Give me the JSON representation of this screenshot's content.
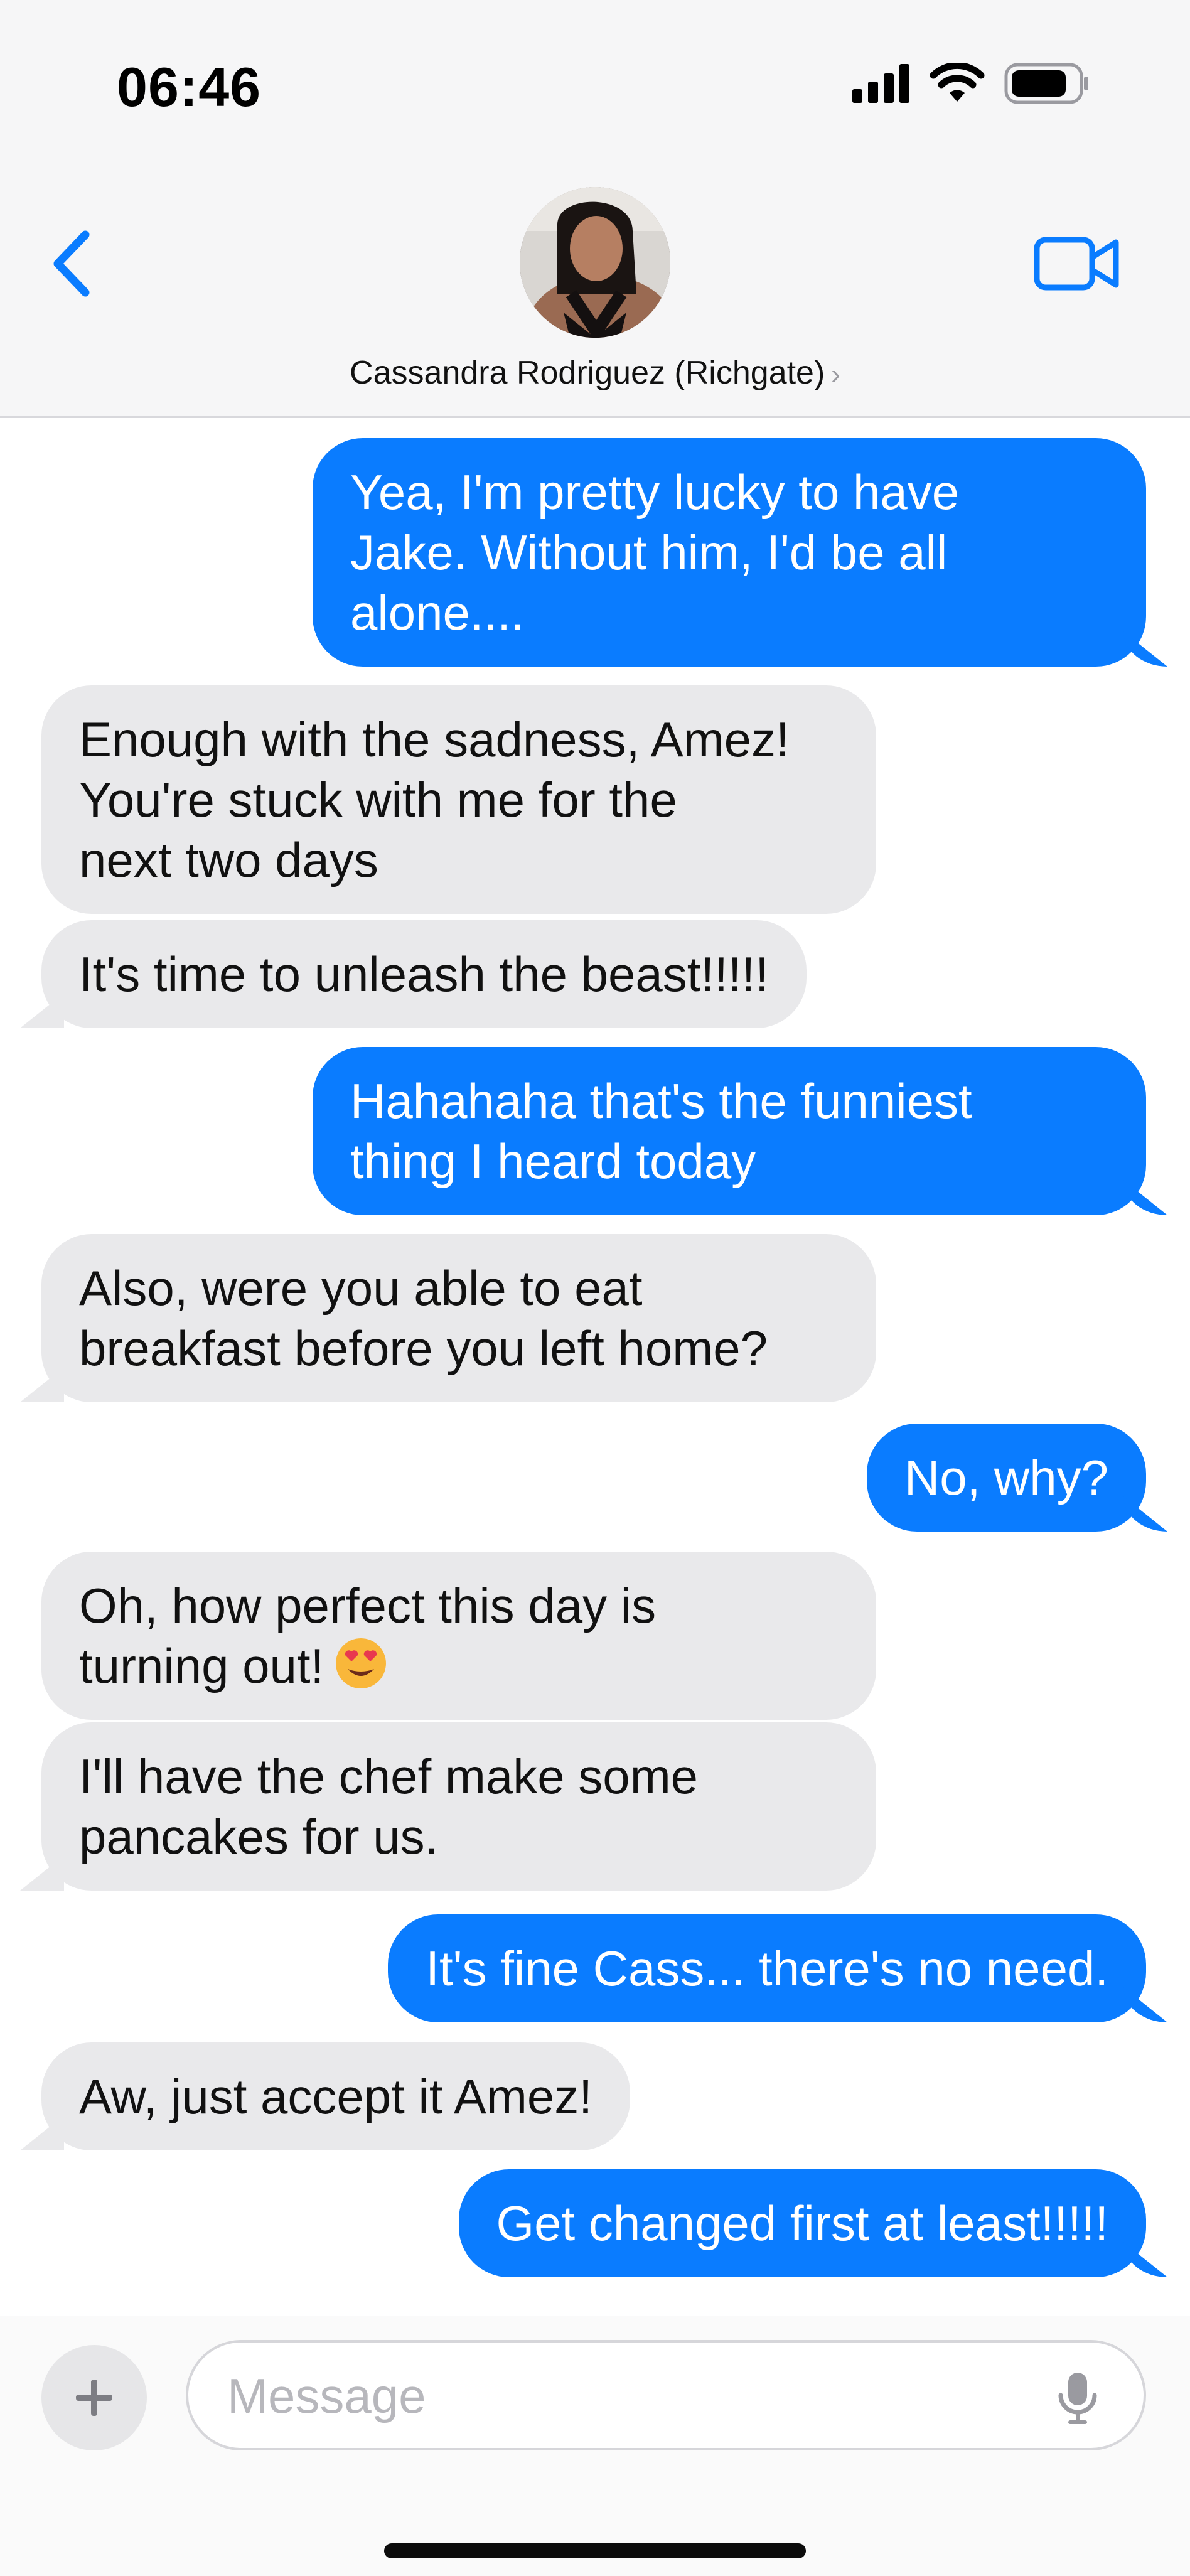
{
  "status_bar": {
    "time": "06:46"
  },
  "header": {
    "contact_name": "Cassandra Rodriguez (Richgate)",
    "chevron": "›",
    "icons": [
      "back-chevron-icon",
      "avatar",
      "video-call-icon"
    ]
  },
  "messages": [
    {
      "from": "me",
      "text": "Yea, I'm pretty lucky to have\nJake. Without him, I'd be all\nalone...."
    },
    {
      "from": "them",
      "text": "Enough with the sadness, Amez!\nYou're stuck with me for the\nnext two days"
    },
    {
      "from": "them",
      "text": "It's time to unleash the beast!!!!!"
    },
    {
      "from": "me",
      "text": "Hahahaha that's the funniest\nthing I heard today"
    },
    {
      "from": "them",
      "text": "Also, were you able to eat\nbreakfast before you left home?"
    },
    {
      "from": "me",
      "text": "No, why?"
    },
    {
      "from": "them",
      "text": "Oh, how perfect this day is\nturning out!"
    },
    {
      "from": "them",
      "text": "I'll have the chef make some\npancakes for us."
    },
    {
      "from": "me",
      "text": "It's fine Cass... there's no need."
    },
    {
      "from": "them",
      "text": "Aw, just accept it Amez!"
    },
    {
      "from": "me",
      "text": "Get changed first at least!!!!!"
    }
  ],
  "composer": {
    "placeholder": "Message",
    "plus_label": "+",
    "icons": [
      "plus-icon",
      "microphone-icon"
    ]
  },
  "colors": {
    "outgoing": "#0a7cff",
    "incoming": "#e9e9eb",
    "accent": "#0a7cff"
  }
}
